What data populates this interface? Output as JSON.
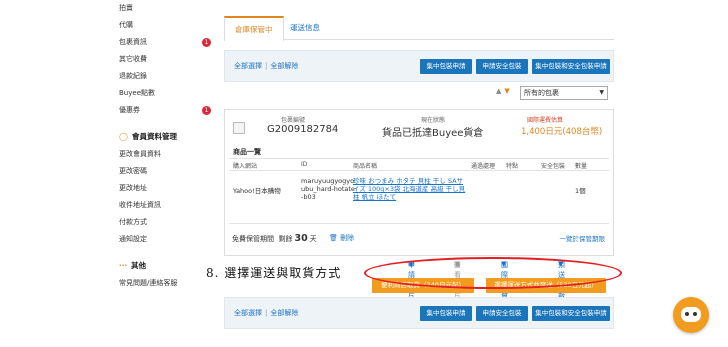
{
  "sidebar": {
    "items_top": [
      {
        "label": "拍賣",
        "badge": ""
      },
      {
        "label": "代購",
        "badge": ""
      },
      {
        "label": "包裹資訊",
        "badge": "1"
      },
      {
        "label": "其它收費",
        "badge": ""
      },
      {
        "label": "退款紀錄",
        "badge": ""
      },
      {
        "label": "Buyee點數",
        "badge": ""
      },
      {
        "label": "優惠券",
        "badge": "1"
      }
    ],
    "member_heading": "會員資料管理",
    "member_items": [
      "更改會員資料",
      "更改密碼",
      "更改地址",
      "收件地址資訊",
      "付款方式",
      "通知設定"
    ],
    "other_heading": "其他",
    "other_items": [
      "常見問題/連絡客服"
    ]
  },
  "tabs": {
    "active": "倉庫保管中",
    "inactive": "運送信息"
  },
  "actions": {
    "select_all": "全部選擇",
    "deselect_all": "全部解除",
    "separator": "|",
    "buttons": [
      "集中包裝申請",
      "申請安全包裝",
      "集中包裝和安全包裝申請"
    ]
  },
  "sort": {
    "arrow_up": "▲",
    "arrow_down": "▼",
    "selected": "所有的包裹",
    "caret": "▼"
  },
  "package": {
    "no_label": "包裹編號",
    "no_value": "G2009182784",
    "status_label": "現在狀態",
    "status_value": "貨品已抵達Buyee貨倉",
    "fee_label": "國際運費估算",
    "fee_value": "1,400日元(408台幣)",
    "items_heading": "商品一覽",
    "columns": [
      "購入網站",
      "ID",
      "商品名稱",
      "通過處理",
      "特點",
      "安全包裝",
      "數量"
    ],
    "item": {
      "site": "Yahoo!日本購物",
      "id": "maruyuugyogyoubu_hard-hotate-b03",
      "name": "珍味 おつまみ ホタテ 貝柱 干し SAサイズ 100g×3袋 北海道産 高級 干し貝柱 帆立 ほたて",
      "qty": "1個"
    },
    "free_label": "免費保管期間",
    "remaining_label": "剩餘",
    "remaining_days": "30",
    "days_unit": "天",
    "delete_label": "刪除",
    "history_link": "一覽於保管期限"
  },
  "links": {
    "photo": "申請照片",
    "view_photo": "查看照片",
    "intl_fee": "國際運費明細",
    "ship_info": "預送情報"
  },
  "shipping": {
    "convenience_btn": "便利商店取貨（240日元起）",
    "choose_btn": "選擇運送方式並發送（530日元起）"
  },
  "annotation": {
    "step": "8.  選擇運送與取貨方式"
  },
  "colors": {
    "accent_orange": "#f29c1f",
    "primary_blue": "#1b75bb",
    "annotation_red": "#e41e25"
  }
}
